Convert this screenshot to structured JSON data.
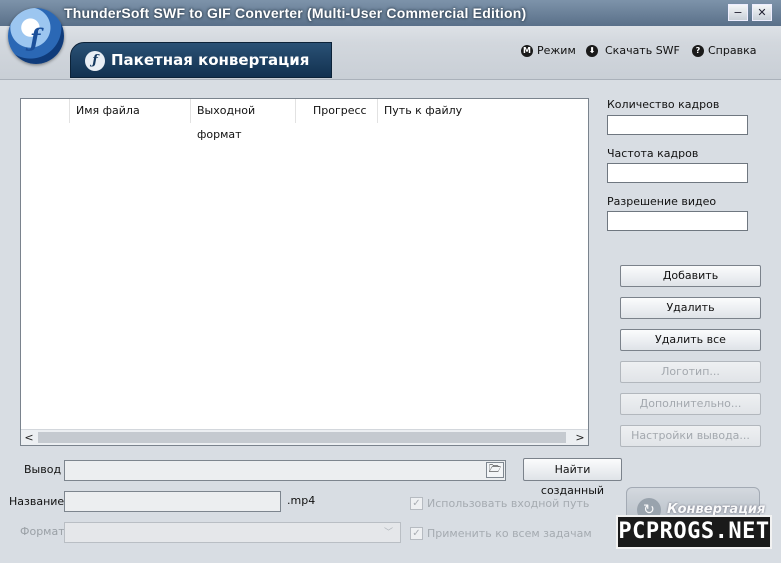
{
  "window": {
    "title": "ThunderSoft SWF to GIF Converter (Multi-User Commercial Edition)",
    "minimize_glyph": "−",
    "close_glyph": "✕"
  },
  "header": {
    "tab_label": "Пакетная конвертация",
    "tab_icon_glyph": "ƒ",
    "logo_glyph": "ƒ",
    "menu": [
      {
        "label": "Режим",
        "icon": "mode-icon",
        "glyph": "M"
      },
      {
        "label": "Скачать SWF",
        "icon": "download-icon",
        "glyph": "⬇"
      },
      {
        "label": "Справка",
        "icon": "help-icon",
        "glyph": "?"
      }
    ]
  },
  "file_list": {
    "columns": [
      "Имя файла",
      "Выходной формат",
      "Прогресс",
      "Путь к файлу"
    ],
    "rows": [],
    "scroll_left_glyph": "<",
    "scroll_right_glyph": ">"
  },
  "properties": {
    "frame_count_label": "Количество кадров",
    "frame_count_value": "",
    "frame_rate_label": "Частота кадров",
    "frame_rate_value": "",
    "resolution_label": "Разрешение видео",
    "resolution_value": ""
  },
  "actions": {
    "add": "Добавить",
    "delete": "Удалить",
    "delete_all": "Удалить все",
    "logo": "Логотип...",
    "advanced": "Дополнительно...",
    "output_settings": "Настройки вывода..."
  },
  "output": {
    "output_label": "Вывод",
    "output_value": "",
    "folder_glyph": "🗁",
    "find_button": "Найти созданный",
    "name_label": "Название",
    "name_value": "",
    "extension": ".mp4",
    "format_label": "Формат",
    "format_value": "",
    "format_arrow_glyph": "﹀",
    "use_input_path": "Использовать входной путь",
    "apply_all": "Применить ко всем задачам",
    "check_glyph": "✓"
  },
  "convert": {
    "label": "Конвертация",
    "icon_glyph": "↻"
  },
  "watermark": "PCPROGS.NET"
}
